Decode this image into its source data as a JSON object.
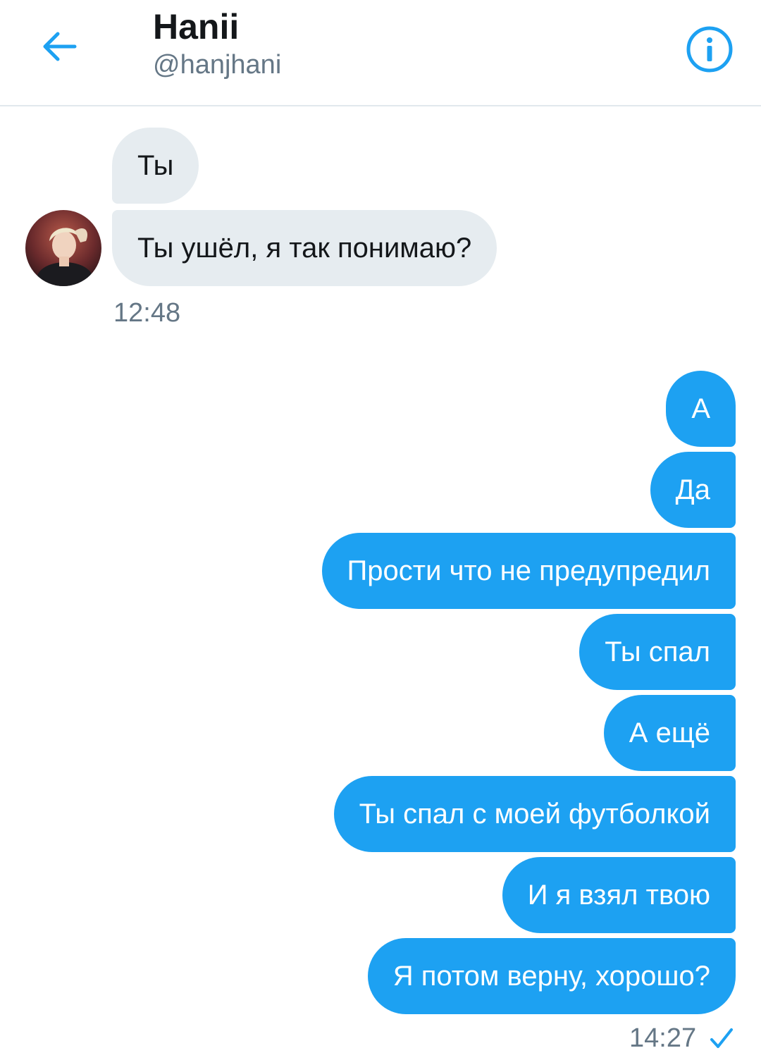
{
  "header": {
    "name": "Hanii",
    "handle": "@hanjhani",
    "back_icon": "arrow-left-icon",
    "info_icon": "info-icon",
    "accent": "#1da1f2"
  },
  "incoming": {
    "messages": [
      "Ты",
      "Ты ушёл, я так понимаю?"
    ],
    "time": "12:48"
  },
  "outgoing": {
    "messages": [
      "А",
      "Да",
      "Прости что не предупредил",
      "Ты спал",
      "А ещё",
      "Ты спал с моей футболкой",
      "И я взял твою",
      "Я потом верну, хорошо?"
    ],
    "time": "14:27",
    "status_icon": "checkmark-icon"
  }
}
